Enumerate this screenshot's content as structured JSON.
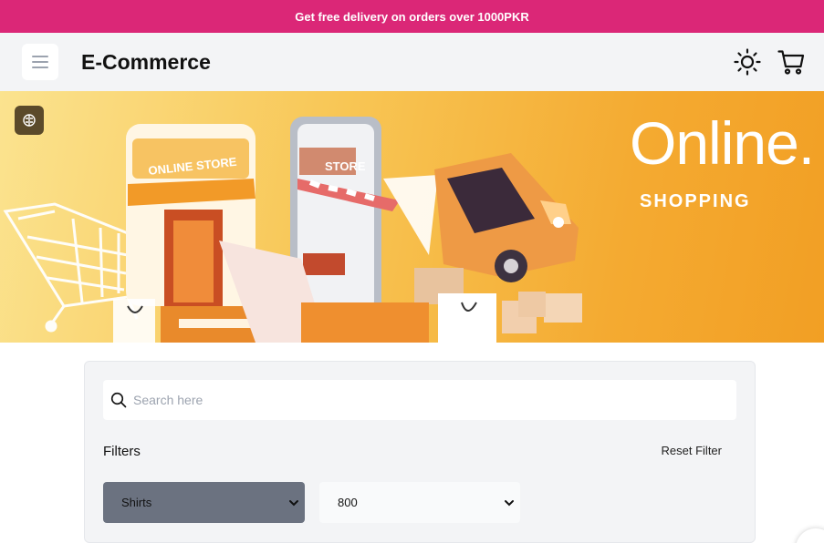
{
  "promo": {
    "text": "Get free delivery on orders over 1000PKR"
  },
  "navbar": {
    "brand": "E-Commerce",
    "icons": [
      "menu-icon",
      "sun-icon",
      "cart-icon"
    ]
  },
  "hero": {
    "title": "Online.",
    "subtitle": "SHOPPING",
    "badge_icon": "brain-icon",
    "illustration_labels": {
      "store_sign": "ONLINE STORE",
      "phone_sign": "STORE"
    }
  },
  "filters": {
    "search_placeholder": "Search here",
    "label": "Filters",
    "reset_label": "Reset Filter",
    "category_value": "Shirts",
    "price_value": "800"
  },
  "colors": {
    "promo_bg": "#db2777",
    "navbar_bg": "#f3f4f6",
    "hero_orange": "#f4aa31",
    "select_dark": "#6b7280"
  }
}
